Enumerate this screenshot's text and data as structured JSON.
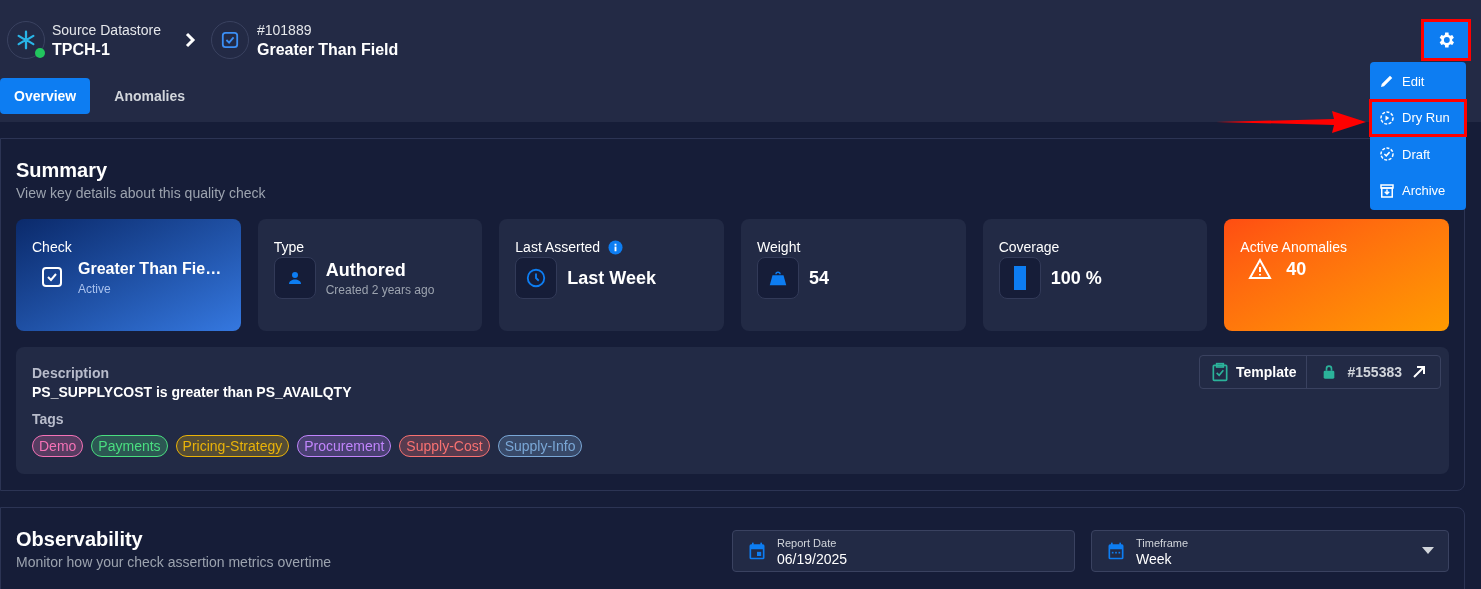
{
  "breadcrumb": {
    "datastore_label": "Source Datastore",
    "datastore_name": "TPCH-1",
    "datastore_online": true,
    "check_id": "#101889",
    "check_name": "Greater Than Field"
  },
  "tabs": [
    {
      "label": "Overview",
      "selected": true
    },
    {
      "label": "Anomalies",
      "selected": false
    }
  ],
  "settings_button": {
    "highlighted": true
  },
  "menu": [
    {
      "label": "Edit",
      "highlighted": false
    },
    {
      "label": "Dry Run",
      "highlighted": true
    },
    {
      "label": "Draft",
      "highlighted": false
    },
    {
      "label": "Archive",
      "highlighted": false
    }
  ],
  "summary": {
    "title": "Summary",
    "subtitle": "View key details about this quality check",
    "cards": [
      {
        "kind": "check",
        "label": "Check",
        "value": "Greater Than Fie…",
        "sub": "Active"
      },
      {
        "kind": "stat",
        "label": "Type",
        "value": "Authored",
        "sub": "Created 2 years ago"
      },
      {
        "kind": "stat",
        "label": "Last Asserted",
        "value": "Last Week",
        "info": true
      },
      {
        "kind": "stat",
        "label": "Weight",
        "value": "54"
      },
      {
        "kind": "stat",
        "label": "Coverage",
        "value": "100 %",
        "level": 1
      },
      {
        "kind": "alert",
        "label": "Active Anomalies",
        "value": "40"
      }
    ],
    "description_label": "Description",
    "description": "PS_SUPPLYCOST is greater than PS_AVAILQTY",
    "template_label": "Template",
    "template_id": "#155383",
    "tags_label": "Tags",
    "tags": [
      {
        "label": "Demo",
        "color": "#f472b6"
      },
      {
        "label": "Payments",
        "color": "#4ade80"
      },
      {
        "label": "Pricing-Strategy",
        "color": "#eab308"
      },
      {
        "label": "Procurement",
        "color": "#c084fc"
      },
      {
        "label": "Supply-Cost",
        "color": "#f87171"
      },
      {
        "label": "Supply-Info",
        "color": "#7aa7d6"
      }
    ]
  },
  "observability": {
    "title": "Observability",
    "subtitle": "Monitor how your check assertion metrics overtime",
    "report_date": {
      "label": "Report Date",
      "value": "06/19/2025"
    },
    "timeframe": {
      "label": "Timeframe",
      "value": "Week"
    }
  }
}
